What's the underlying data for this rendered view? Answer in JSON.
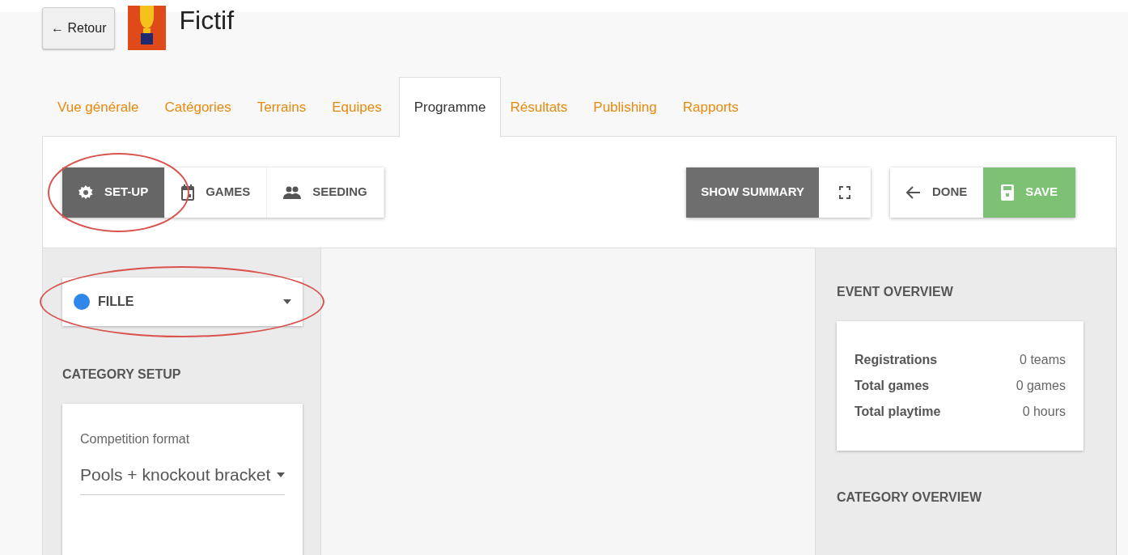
{
  "header": {
    "back_button": "← Retour",
    "title": "Fictif"
  },
  "tabs": [
    {
      "label": "Vue générale",
      "selected": false
    },
    {
      "label": "Catégories",
      "selected": false
    },
    {
      "label": "Terrains",
      "selected": false
    },
    {
      "label": "Equipes",
      "selected": false
    },
    {
      "label": "Programme",
      "selected": true
    },
    {
      "label": "Résultats",
      "selected": false
    },
    {
      "label": "Publishing",
      "selected": false
    },
    {
      "label": "Rapports",
      "selected": false
    }
  ],
  "toolbar": {
    "modes": [
      {
        "label": "SET-UP",
        "kind": "gear",
        "selected": true,
        "circled": true
      },
      {
        "label": "GAMES",
        "kind": "calendar",
        "selected": false,
        "circled": false
      },
      {
        "label": "SEEDING",
        "kind": "people",
        "selected": false,
        "circled": false
      }
    ],
    "show_summary": "SHOW SUMMARY",
    "done": "DONE",
    "save": "SAVE"
  },
  "left_panel": {
    "category": {
      "value": "FILLE",
      "color": "#2f86eb",
      "circled": true
    },
    "section_title": "CATEGORY SETUP",
    "fields": [
      {
        "label": "Competition format",
        "value": "Pools + knockout bracket"
      }
    ]
  },
  "right_panel": {
    "event_title": "EVENT OVERVIEW",
    "stats": [
      {
        "label": "Registrations",
        "value": "0 teams"
      },
      {
        "label": "Total games",
        "value": "0 games"
      },
      {
        "label": "Total playtime",
        "value": "0 hours"
      }
    ],
    "category_title": "CATEGORY OVERVIEW"
  }
}
